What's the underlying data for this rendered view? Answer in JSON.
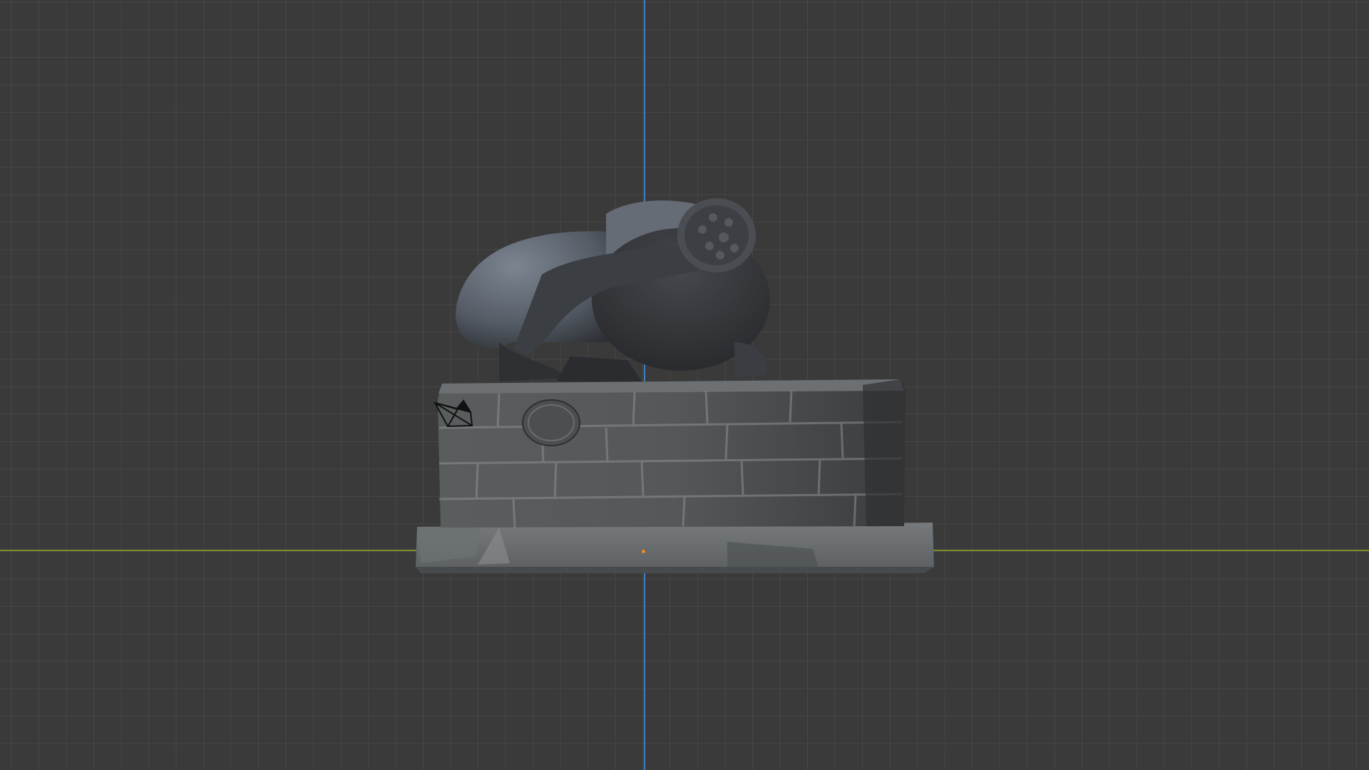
{
  "app": "Blender",
  "viewport": {
    "view": "front-orthographic",
    "background_color": "#3a3a3a",
    "grid_color": "#505050",
    "axis_colors": {
      "z_axis": "#3f7cc0",
      "x_axis": "#7d8f2a"
    }
  },
  "scene_objects": [
    {
      "name_icon": "statue-mesh",
      "kind": "scanned 3D model"
    },
    {
      "name_icon": "camera-icon",
      "kind": "camera"
    },
    {
      "name_icon": "origin-point",
      "kind": "object origin",
      "color": "#f08a1e"
    }
  ]
}
